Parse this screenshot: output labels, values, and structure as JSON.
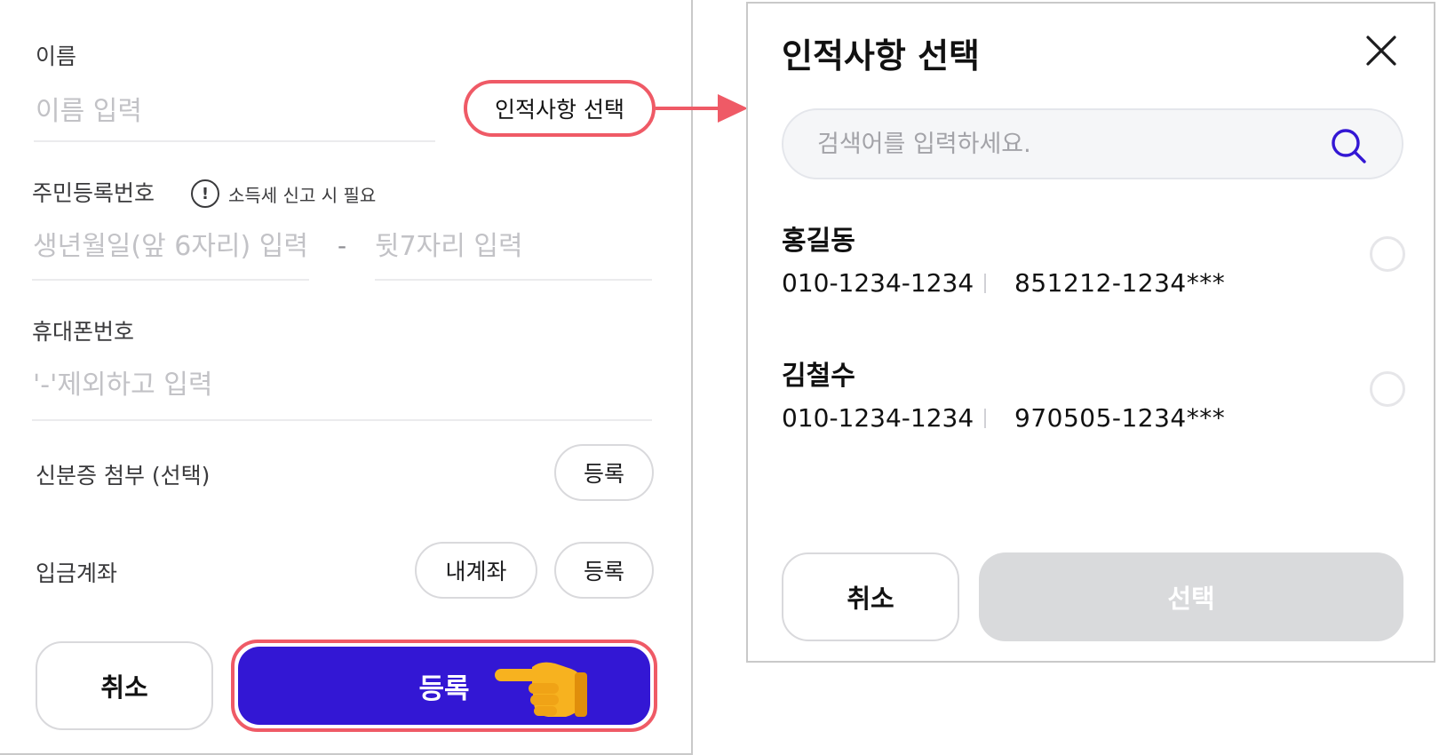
{
  "form": {
    "name_label": "이름",
    "name_placeholder": "이름 입력",
    "pick_person_button": "인적사항 선택",
    "rrn_label": "주민등록번호",
    "rrn_info": "소득세 신고 시 필요",
    "rrn_front_placeholder": "생년월일(앞 6자리) 입력",
    "rrn_separator": "-",
    "rrn_back_placeholder": "뒷7자리 입력",
    "phone_label": "휴대폰번호",
    "phone_placeholder": "'-'제외하고 입력",
    "id_attach_label": "신분증 첨부 (선택)",
    "id_attach_button": "등록",
    "account_label": "입금계좌",
    "my_account_button": "내계좌",
    "account_register_button": "등록",
    "cancel_button": "취소",
    "submit_button": "등록"
  },
  "modal": {
    "title": "인적사항 선택",
    "search_placeholder": "검색어를 입력하세요.",
    "people": [
      {
        "name": "홍길동",
        "phone": "010-1234-1234",
        "rrn": "851212-1234***"
      },
      {
        "name": "김철수",
        "phone": "010-1234-1234",
        "rrn": "970505-1234***"
      }
    ],
    "cancel_button": "취소",
    "select_button": "선택"
  },
  "colors": {
    "primary": "#3317d4",
    "highlight": "#ef5a66",
    "disabled": "#d9dadc"
  },
  "icons": {
    "info": "exclamation-circle-icon",
    "close": "close-icon",
    "search": "search-icon",
    "pointer": "pointing-hand-icon",
    "arrow": "arrow-right-icon"
  }
}
